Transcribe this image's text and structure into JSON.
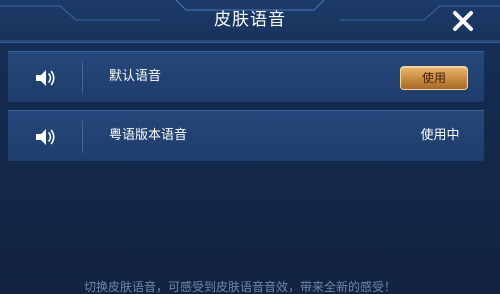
{
  "dialog": {
    "title": "皮肤语音",
    "close_icon": "close-icon"
  },
  "voices": [
    {
      "icon": "speaker-icon",
      "label": "默认语音",
      "action_label": "使用"
    },
    {
      "icon": "speaker-icon",
      "label": "粤语版本语音",
      "status_label": "使用中"
    }
  ],
  "footer": {
    "hint": "切换皮肤语音，可感受到皮肤语音音效，带来全新的感受！"
  },
  "colors": {
    "background": "#11233f",
    "row": "#224273",
    "accent_gold": "#c98a3d",
    "text": "#ffffff"
  }
}
